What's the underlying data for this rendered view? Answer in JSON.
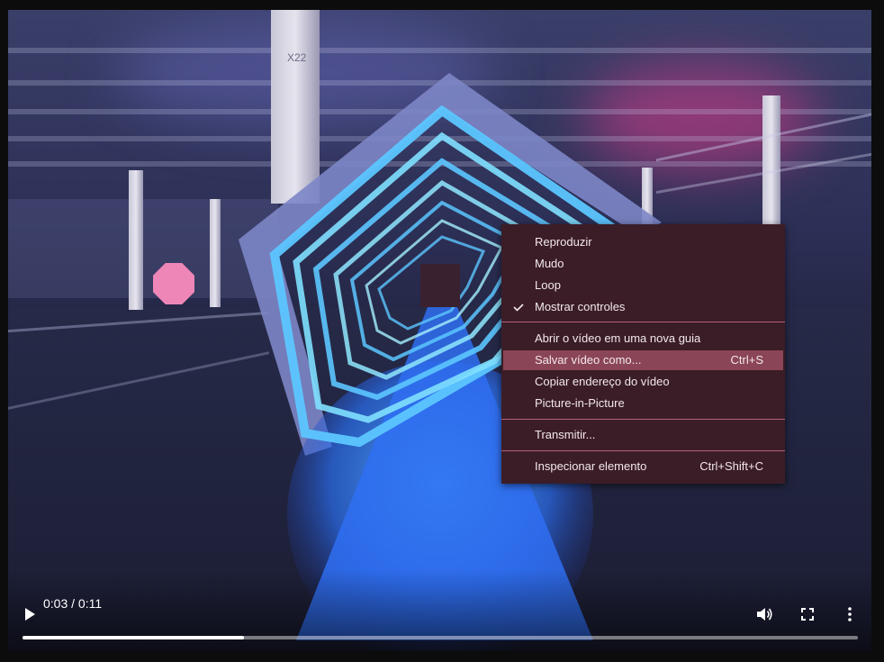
{
  "player": {
    "current_time": "0:03",
    "duration": "0:11",
    "time_display": "0:03 / 0:11",
    "progress_fraction": 0.265
  },
  "icons": {
    "play": "play-icon",
    "volume": "volume-icon",
    "fullscreen": "fullscreen-icon",
    "more": "more-options-icon"
  },
  "scene": {
    "pillar_label": "X22"
  },
  "context_menu": {
    "items": [
      {
        "label": "Reproduzir",
        "shortcut": "",
        "checked": false
      },
      {
        "label": "Mudo",
        "shortcut": "",
        "checked": false
      },
      {
        "label": "Loop",
        "shortcut": "",
        "checked": false
      },
      {
        "label": "Mostrar controles",
        "shortcut": "",
        "checked": true
      },
      {
        "label": "Abrir o vídeo em uma nova guia",
        "shortcut": ""
      },
      {
        "label": "Salvar vídeo como...",
        "shortcut": "Ctrl+S",
        "highlighted": true
      },
      {
        "label": "Copiar endereço do vídeo",
        "shortcut": ""
      },
      {
        "label": "Picture-in-Picture",
        "shortcut": ""
      },
      {
        "label": "Transmitir...",
        "shortcut": ""
      },
      {
        "label": "Inspecionar elemento",
        "shortcut": "Ctrl+Shift+C"
      }
    ]
  },
  "colors": {
    "menu_background": "#3b1d27",
    "menu_highlight": "#8a4556",
    "menu_separator": "#b4607a",
    "menu_text": "#f2e8ec",
    "portal_glow": "#3fa7ff"
  }
}
